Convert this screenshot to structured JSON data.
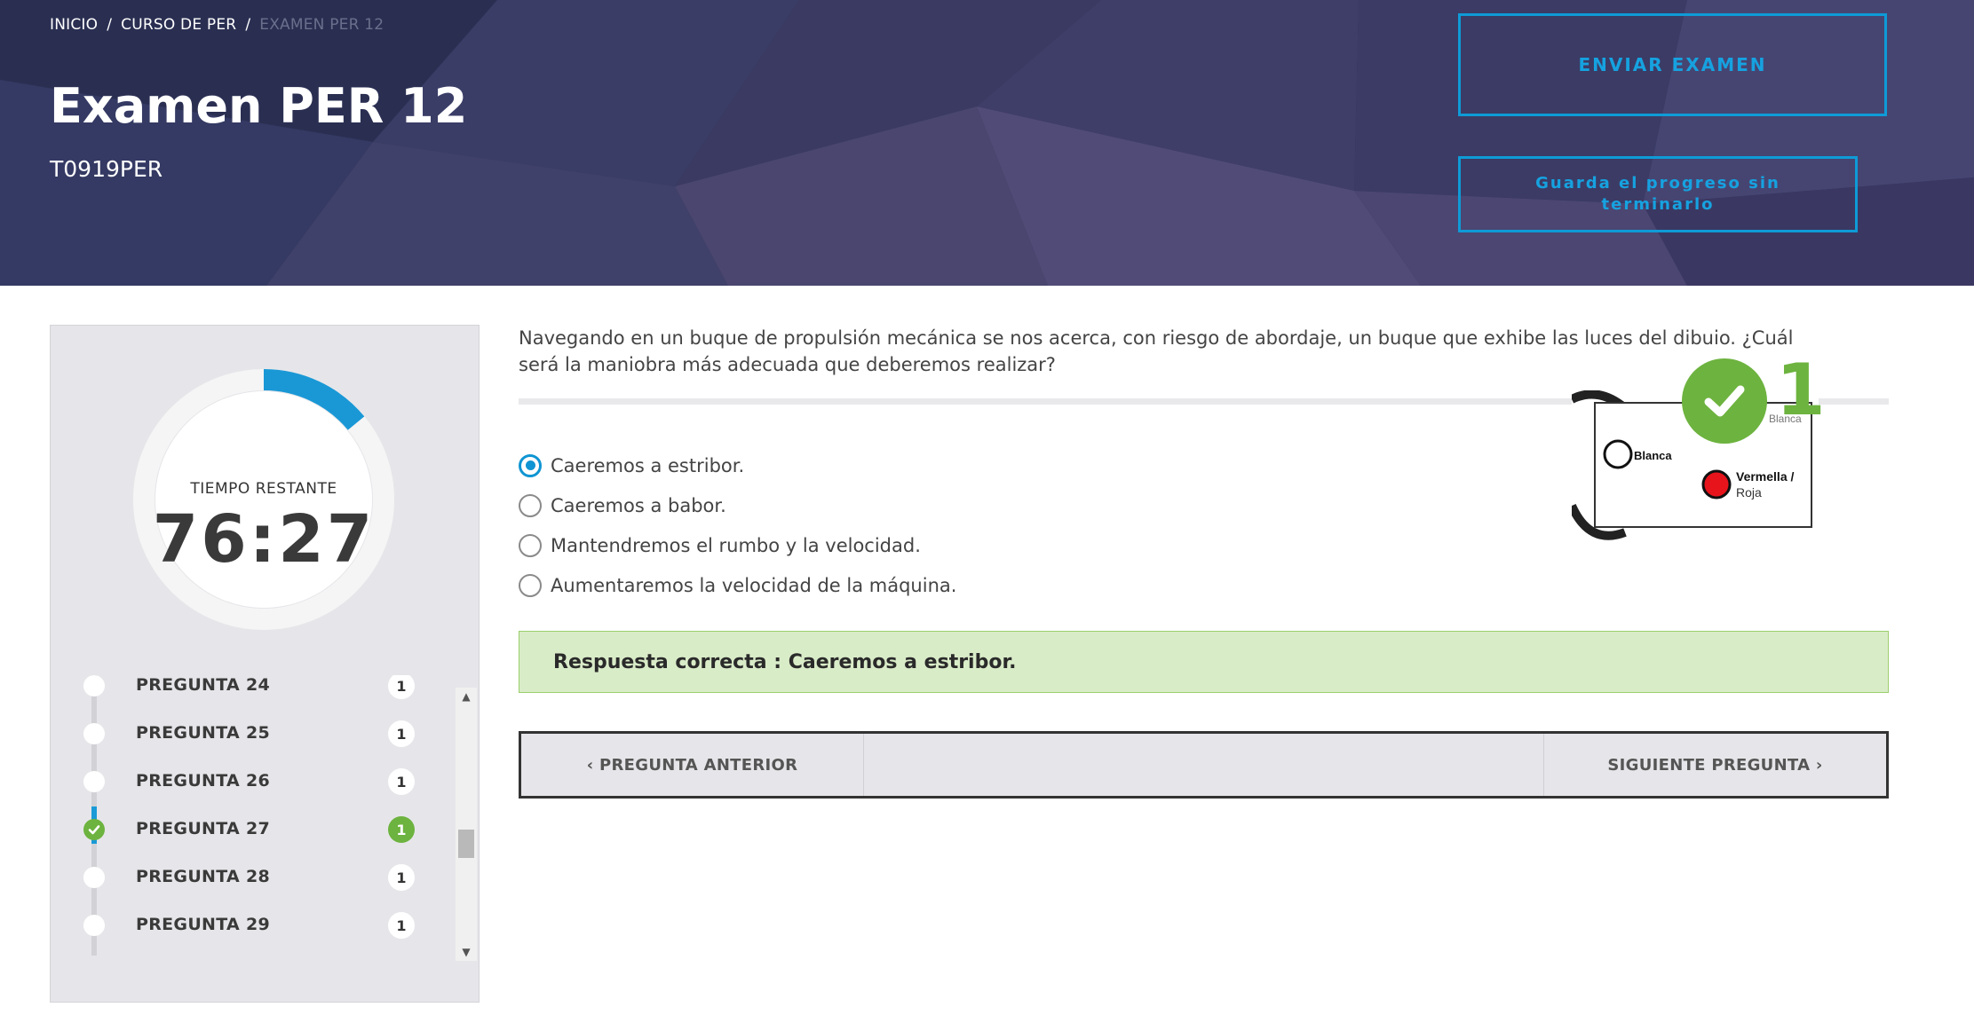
{
  "breadcrumb": {
    "items": [
      "INICIO",
      "CURSO DE PER"
    ],
    "current": "EXAMEN PER 12",
    "separator": "/"
  },
  "header": {
    "title": "Examen PER 12",
    "subtitle": "T0919PER",
    "send_button": "ENVIAR EXAMEN",
    "save_button": "Guarda el progreso sin terminarlo"
  },
  "timer": {
    "label": "TIEMPO RESTANTE",
    "value": "76:27",
    "elapsed_fraction": 0.14
  },
  "questions": [
    {
      "label": "PREGUNTA 24",
      "points": "1",
      "answered": false
    },
    {
      "label": "PREGUNTA 25",
      "points": "1",
      "answered": false
    },
    {
      "label": "PREGUNTA 26",
      "points": "1",
      "answered": false
    },
    {
      "label": "PREGUNTA 27",
      "points": "1",
      "answered": true
    },
    {
      "label": "PREGUNTA 28",
      "points": "1",
      "answered": false
    },
    {
      "label": "PREGUNTA 29",
      "points": "1",
      "answered": false
    }
  ],
  "question": {
    "text": "Navegando en un buque de propulsión mecánica se nos acerca, con riesgo de abordaje, un buque que exhibe las luces del dibuio. ¿Cuál será la maniobra más adecuada que deberemos realizar?",
    "options": [
      {
        "label": "Caeremos a estribor.",
        "selected": true
      },
      {
        "label": "Caeremos a babor.",
        "selected": false
      },
      {
        "label": "Mantendremos el rumbo y la velocidad.",
        "selected": false
      },
      {
        "label": "Aumentaremos la velocidad de la máquina.",
        "selected": false
      }
    ],
    "figure": {
      "label_white": "Blanca",
      "label_white_top": "Blanca",
      "label_red_1": "Vermella /",
      "label_red_2": "Roja"
    },
    "score": "1"
  },
  "feedback": {
    "text": "Respuesta correcta : Caeremos a estribor."
  },
  "navigation": {
    "prev": "‹ PREGUNTA ANTERIOR",
    "next": "SIGUIENTE PREGUNTA ›"
  },
  "colors": {
    "accent": "#0f95d3",
    "success": "#6db33f",
    "banner": "#2e3357",
    "feedback_bg": "#d9ecc8"
  },
  "icons": {
    "check": "check-icon",
    "scroll_up": "caret-up-icon",
    "scroll_down": "caret-down-icon"
  }
}
